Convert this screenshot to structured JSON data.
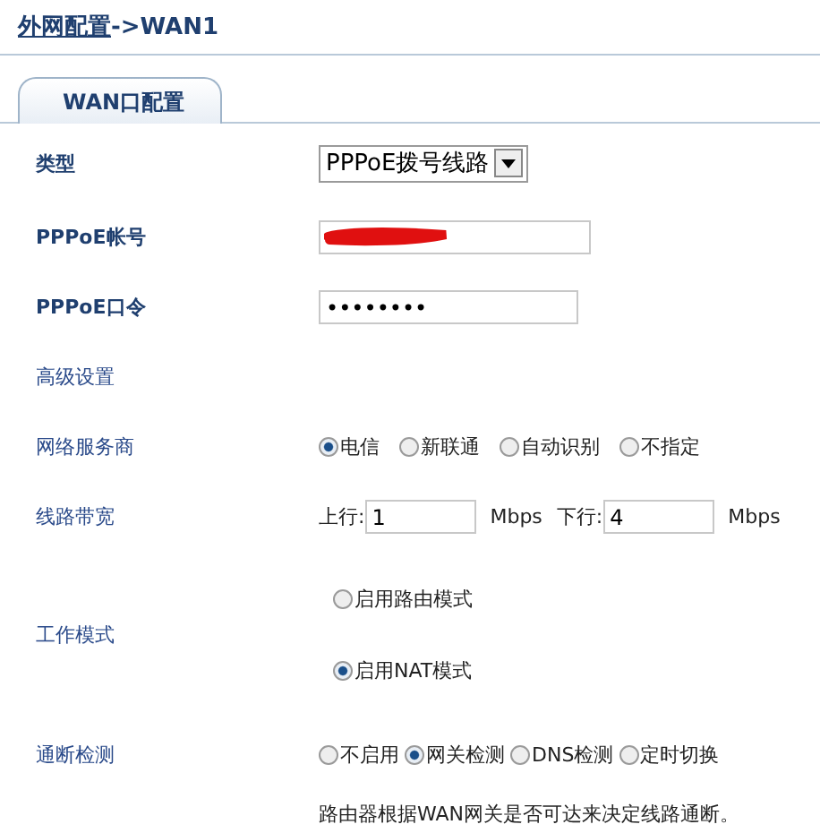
{
  "breadcrumb": {
    "link": "外网配置",
    "separator": "->",
    "current": "WAN1"
  },
  "tabs": [
    {
      "label": "WAN口配置",
      "selected": true
    }
  ],
  "type": {
    "label": "类型",
    "value": "PPPoE拨号线路"
  },
  "account": {
    "label": "PPPoE帐号",
    "redacted": true
  },
  "password": {
    "label": "PPPoE口令",
    "value": "••••••••"
  },
  "advanced": {
    "label": "高级设置"
  },
  "isp": {
    "label": "网络服务商",
    "options": [
      {
        "label": "电信",
        "selected": true
      },
      {
        "label": "新联通",
        "selected": false
      },
      {
        "label": "自动识别",
        "selected": false
      },
      {
        "label": "不指定",
        "selected": false
      }
    ]
  },
  "bandwidth": {
    "label": "线路带宽",
    "up_label": "上行:",
    "up_value": "1",
    "up_unit": "Mbps",
    "down_label": "下行:",
    "down_value": "4",
    "down_unit": "Mbps"
  },
  "work_mode": {
    "label": "工作模式",
    "options": [
      {
        "label": "启用路由模式",
        "selected": false
      },
      {
        "label": "启用NAT模式",
        "selected": true
      }
    ]
  },
  "detection": {
    "label": "通断检测",
    "options": [
      {
        "label": "不启用",
        "selected": false
      },
      {
        "label": "网关检测",
        "selected": true
      },
      {
        "label": "DNS检测",
        "selected": false
      },
      {
        "label": "定时切换",
        "selected": false
      }
    ],
    "note": "路由器根据WAN网关是否可达来决定线路通断。"
  }
}
